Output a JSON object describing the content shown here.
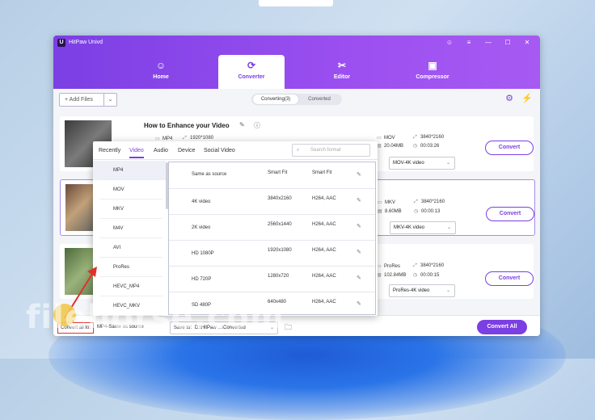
{
  "app": {
    "title": "HitPaw Univd",
    "logo_letter": "U"
  },
  "window_controls": [
    "☺",
    "≡",
    "—",
    "☐",
    "✕"
  ],
  "nav_tabs": [
    {
      "label": "Home",
      "icon": "☺"
    },
    {
      "label": "Converter",
      "icon": "⟳"
    },
    {
      "label": "Editor",
      "icon": "✂"
    },
    {
      "label": "Compressor",
      "icon": "▣"
    }
  ],
  "toolbar": {
    "add_files": "+ Add Files",
    "dropdown_icon": "⌄",
    "segments": [
      "Converting(3)",
      "Converted"
    ],
    "icons": [
      "⚙",
      "⚡"
    ]
  },
  "files": [
    {
      "title": "How to Enhance your Video",
      "src_format": "MP4",
      "src_res": "1920*1080",
      "dst_format": "MOV",
      "dst_res": "3840*2160",
      "size": "20.04MB",
      "duration": "00:03:26",
      "output_select": "MOV-4K video",
      "convert_label": "Convert"
    },
    {
      "title": "",
      "dst_format": "MKV",
      "dst_res": "3840*2160",
      "size": "8.60MB",
      "duration": "00:00:13",
      "output_select": "MKV-4K video",
      "convert_label": "Convert"
    },
    {
      "title": "",
      "dst_format": "ProRes",
      "dst_res": "3840*2160",
      "size": "102.84MB",
      "duration": "00:00:15",
      "output_select": "ProRes-4K video",
      "convert_label": "Convert"
    }
  ],
  "bottom": {
    "convert_all_to": "Convert all to:",
    "convert_all_value": "MP4-Same as source",
    "save_to": "Save to:",
    "save_path": "D:\\HitPaw ...\\Converted",
    "convert_all_button": "Convert All"
  },
  "popup": {
    "tabs": [
      "Recently",
      "Video",
      "Audio",
      "Device",
      "Social Video"
    ],
    "active_tab": "Video",
    "search_placeholder": "Search format",
    "formats": [
      "MP4",
      "MOV",
      "MKV",
      "M4V",
      "AVI",
      "ProRes",
      "HEVC_MP4",
      "HEVC_MKV"
    ],
    "selected_format": "MP4",
    "presets": [
      {
        "name": "Same as source",
        "res": "Smart Fit",
        "codec": "Smart Fit"
      },
      {
        "name": "4K video",
        "res": "3840x2160",
        "codec": "H264, AAC"
      },
      {
        "name": "2K video",
        "res": "2560x1440",
        "codec": "H264, AAC"
      },
      {
        "name": "HD 1080P",
        "res": "1920x1080",
        "codec": "H264, AAC"
      },
      {
        "name": "HD 720P",
        "res": "1280x720",
        "codec": "H264, AAC"
      },
      {
        "name": "SD 480P",
        "res": "640x480",
        "codec": "H264, AAC"
      }
    ]
  },
  "watermark": "filehorse.com",
  "colors": {
    "accent": "#7b3fe4",
    "header_start": "#7b3fe4",
    "header_end": "#a75af2"
  }
}
